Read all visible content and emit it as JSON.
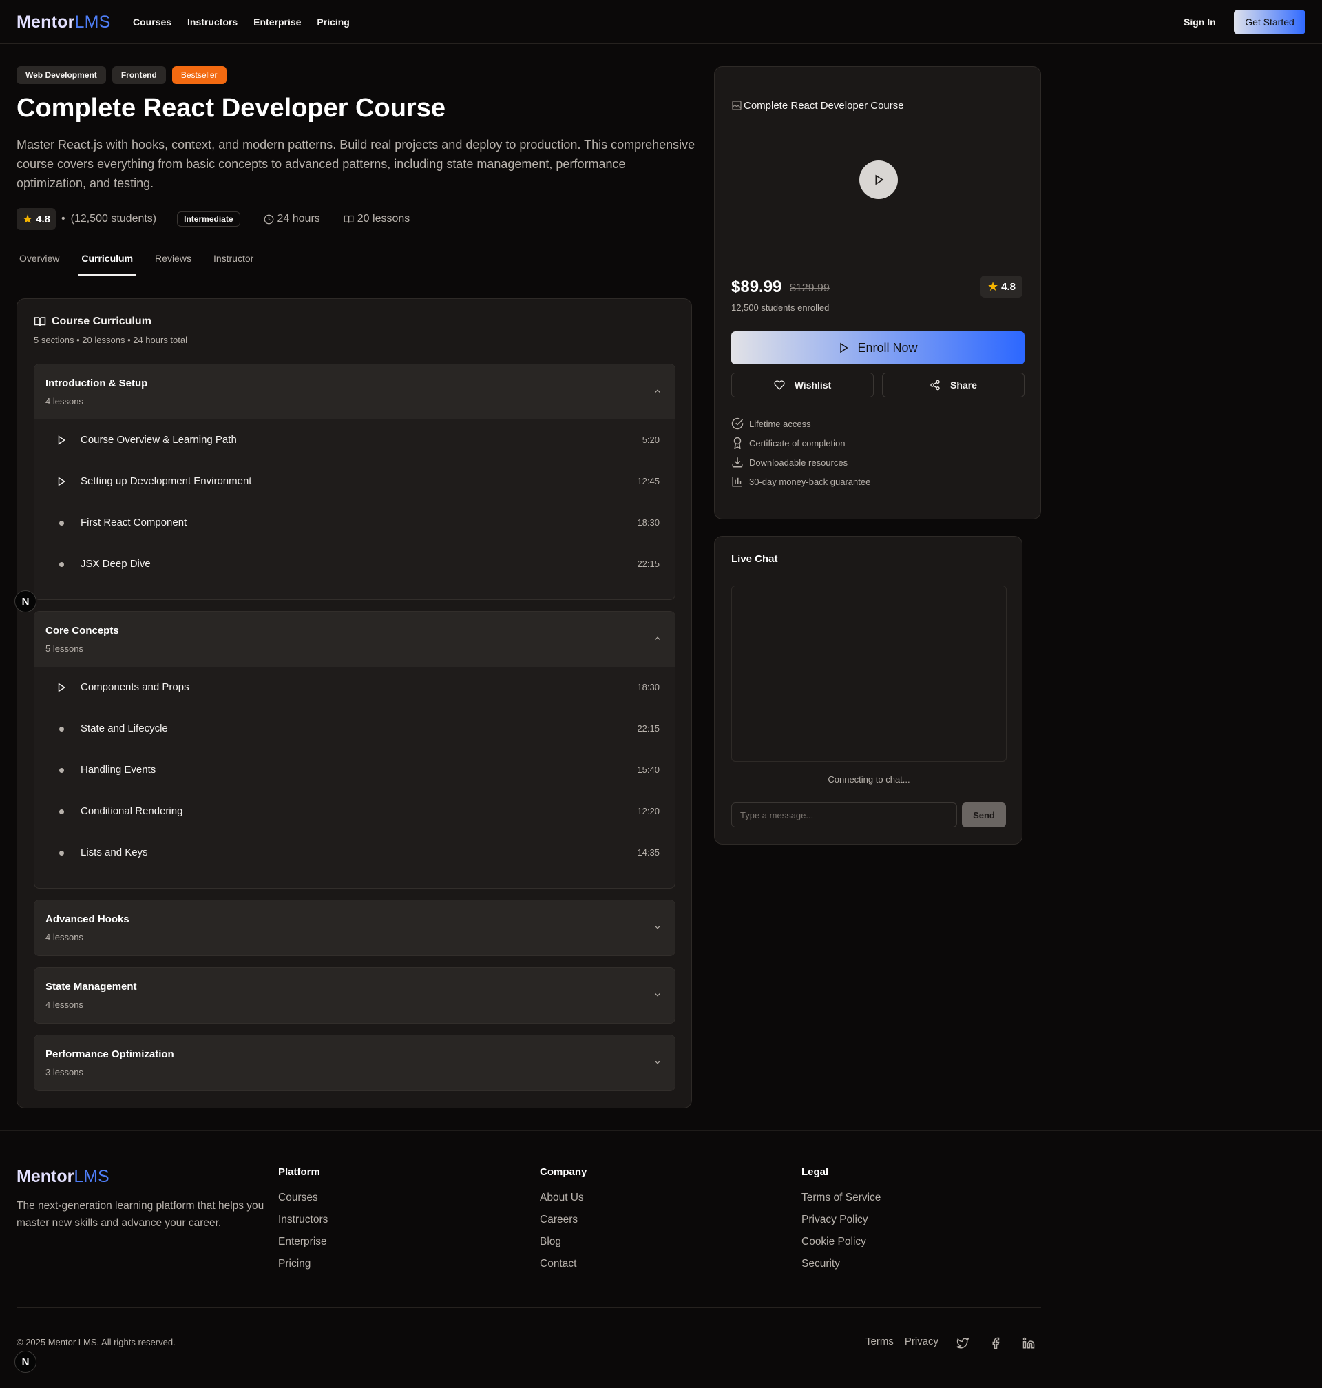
{
  "header": {
    "logo_main": "Mentor",
    "logo_accent": "LMS",
    "nav": [
      "Courses",
      "Instructors",
      "Enterprise",
      "Pricing"
    ],
    "sign_in": "Sign In",
    "get_started": "Get Started"
  },
  "course": {
    "tags": [
      "Web Development",
      "Frontend",
      "Bestseller"
    ],
    "title": "Complete React Developer Course",
    "description": "Master React.js with hooks, context, and modern patterns. Build real projects and deploy to production. This comprehensive course covers everything from basic concepts to advanced patterns, including state management, performance optimization, and testing.",
    "rating": "4.8",
    "students": "(12,500 students)",
    "level": "Intermediate",
    "duration": "24 hours",
    "lessons": "20 lessons"
  },
  "tabs": [
    "Overview",
    "Curriculum",
    "Reviews",
    "Instructor"
  ],
  "curriculum": {
    "heading": "Course Curriculum",
    "summary": "5 sections • 20 lessons • 24 hours total",
    "sections": [
      {
        "title": "Introduction & Setup",
        "count": "4 lessons",
        "lessons": [
          {
            "title": "Course Overview & Learning Path",
            "time": "5:20"
          },
          {
            "title": "Setting up Development Environment",
            "time": "12:45"
          },
          {
            "title": "First React Component",
            "time": "18:30"
          },
          {
            "title": "JSX Deep Dive",
            "time": "22:15"
          }
        ]
      },
      {
        "title": "Core Concepts",
        "count": "5 lessons",
        "lessons": [
          {
            "title": "Components and Props",
            "time": "18:30"
          },
          {
            "title": "State and Lifecycle",
            "time": "22:15"
          },
          {
            "title": "Handling Events",
            "time": "15:40"
          },
          {
            "title": "Conditional Rendering",
            "time": "12:20"
          },
          {
            "title": "Lists and Keys",
            "time": "14:35"
          }
        ]
      },
      {
        "title": "Advanced Hooks",
        "count": "4 lessons"
      },
      {
        "title": "State Management",
        "count": "4 lessons"
      },
      {
        "title": "Performance Optimization",
        "count": "3 lessons"
      }
    ]
  },
  "purchase": {
    "image_alt": "Complete React Developer Course",
    "price": "$89.99",
    "old_price": "$129.99",
    "enrolled": "12,500 students enrolled",
    "rating": "4.8",
    "enroll": "Enroll Now",
    "wishlist": "Wishlist",
    "share": "Share",
    "features": [
      "Lifetime access",
      "Certificate of completion",
      "Downloadable resources",
      "30-day money-back guarantee"
    ]
  },
  "chat": {
    "title": "Live Chat",
    "status": "Connecting to chat...",
    "placeholder": "Type a message...",
    "send": "Send"
  },
  "badge": "N",
  "footer": {
    "logo_main": "Mentor",
    "logo_accent": "LMS",
    "tagline": "The next-generation learning platform that helps you master new skills and advance your career.",
    "platform": {
      "title": "Platform",
      "links": [
        "Courses",
        "Instructors",
        "Enterprise",
        "Pricing"
      ]
    },
    "company": {
      "title": "Company",
      "links": [
        "About Us",
        "Careers",
        "Blog",
        "Contact"
      ]
    },
    "legal": {
      "title": "Legal",
      "links": [
        "Terms of Service",
        "Privacy Policy",
        "Cookie Policy",
        "Security"
      ]
    },
    "copyright": "© 2025 Mentor LMS. All rights reserved.",
    "bottom_links": [
      "Terms",
      "Privacy"
    ],
    "social_icons": [
      "twitter-icon",
      "facebook-icon",
      "linkedin-icon"
    ]
  }
}
